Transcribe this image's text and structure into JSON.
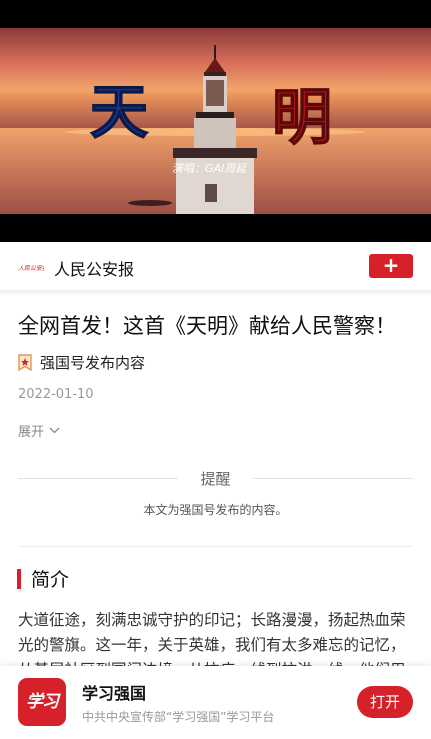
{
  "video": {
    "title_left": "天",
    "title_right": "明",
    "credit": "演唱：GAI周延"
  },
  "source": {
    "logo_text": "人民公安报",
    "name": "人民公安报",
    "follow_label": "+"
  },
  "article": {
    "title": "全网首发！这首《天明》献给人民警察！",
    "publisher_label": "强国号发布内容",
    "date": "2022-01-10",
    "expand_label": "展开"
  },
  "notice": {
    "title": "提醒",
    "text": "本文为强国号发布的内容。"
  },
  "intro": {
    "heading": "简介",
    "text": "大道征途，刻满忠诚守护的印记；长路漫漫，扬起热血荣光的警旗。这一年，关于英雄，我们有太多难忘的记忆，从基层社区到国门边境，从抗疫一线到抗洪一线，他们用"
  },
  "app_banner": {
    "logo_text": "学习",
    "name": "学习强国",
    "description": "中共中央宣传部“学习强国”学习平台",
    "open_label": "打开"
  },
  "colors": {
    "brand_red": "#d6212a",
    "title_blue": "#1f3a9c",
    "title_red": "#c4161c"
  }
}
